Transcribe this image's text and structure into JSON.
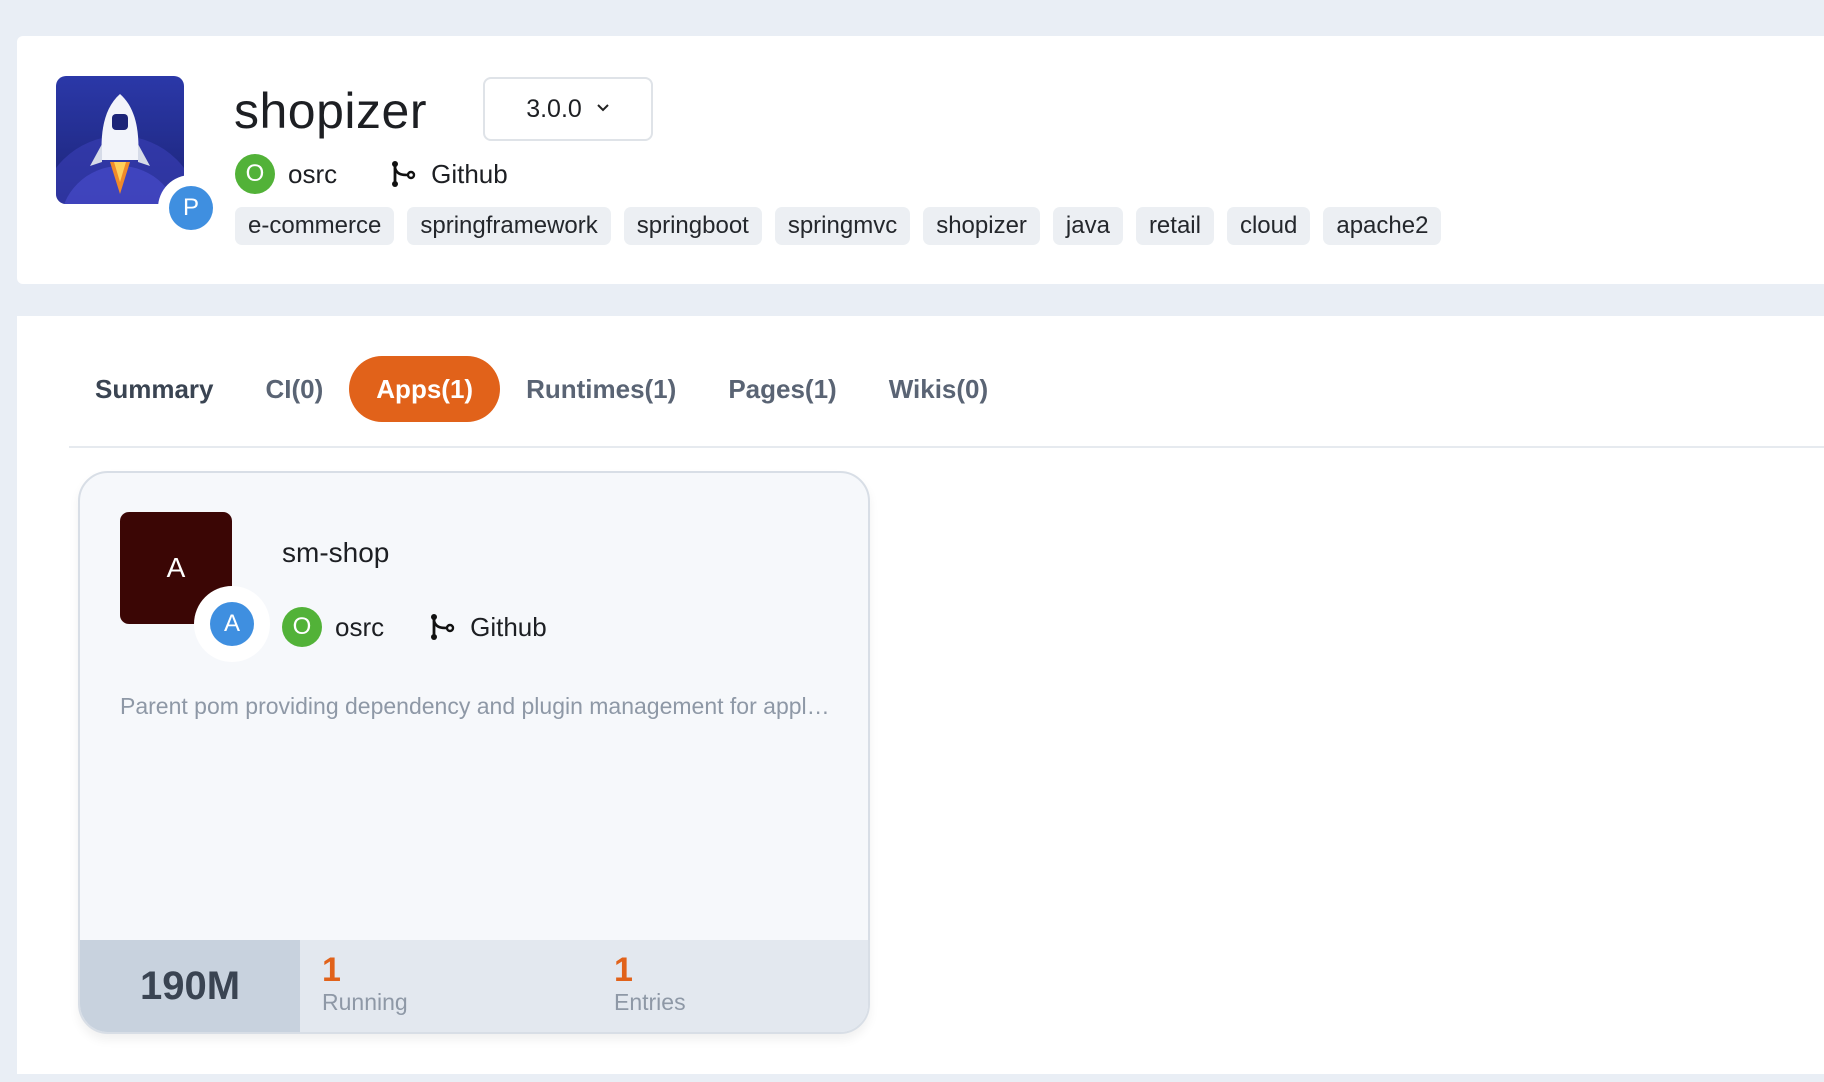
{
  "project": {
    "name": "shopizer",
    "badge_letter": "P",
    "version": "3.0.0",
    "owner": {
      "initial": "O",
      "name": "osrc"
    },
    "source": {
      "icon": "git-branch-icon",
      "name": "Github"
    },
    "tags": [
      "e-commerce",
      "springframework",
      "springboot",
      "springmvc",
      "shopizer",
      "java",
      "retail",
      "cloud",
      "apache2"
    ]
  },
  "tabs": [
    {
      "label": "Summary"
    },
    {
      "label": "CI(0)"
    },
    {
      "label": "Apps(1)",
      "active": true
    },
    {
      "label": "Runtimes(1)"
    },
    {
      "label": "Pages(1)"
    },
    {
      "label": "Wikis(0)"
    }
  ],
  "app": {
    "avatar_letter": "A",
    "badge_letter": "A",
    "name": "sm-shop",
    "owner": {
      "initial": "O",
      "name": "osrc"
    },
    "source": {
      "icon": "git-branch-icon",
      "name": "Github"
    },
    "description": "Parent pom providing dependency and plugin management for applications built with Maven",
    "size": "190M",
    "running": {
      "value": "1",
      "label": "Running"
    },
    "entries": {
      "value": "1",
      "label": "Entries"
    }
  },
  "colors": {
    "accent": "#e1621a",
    "owner_green": "#52b238",
    "badge_blue": "#3f8fe0",
    "app_avatar_bg": "#3b0605"
  }
}
